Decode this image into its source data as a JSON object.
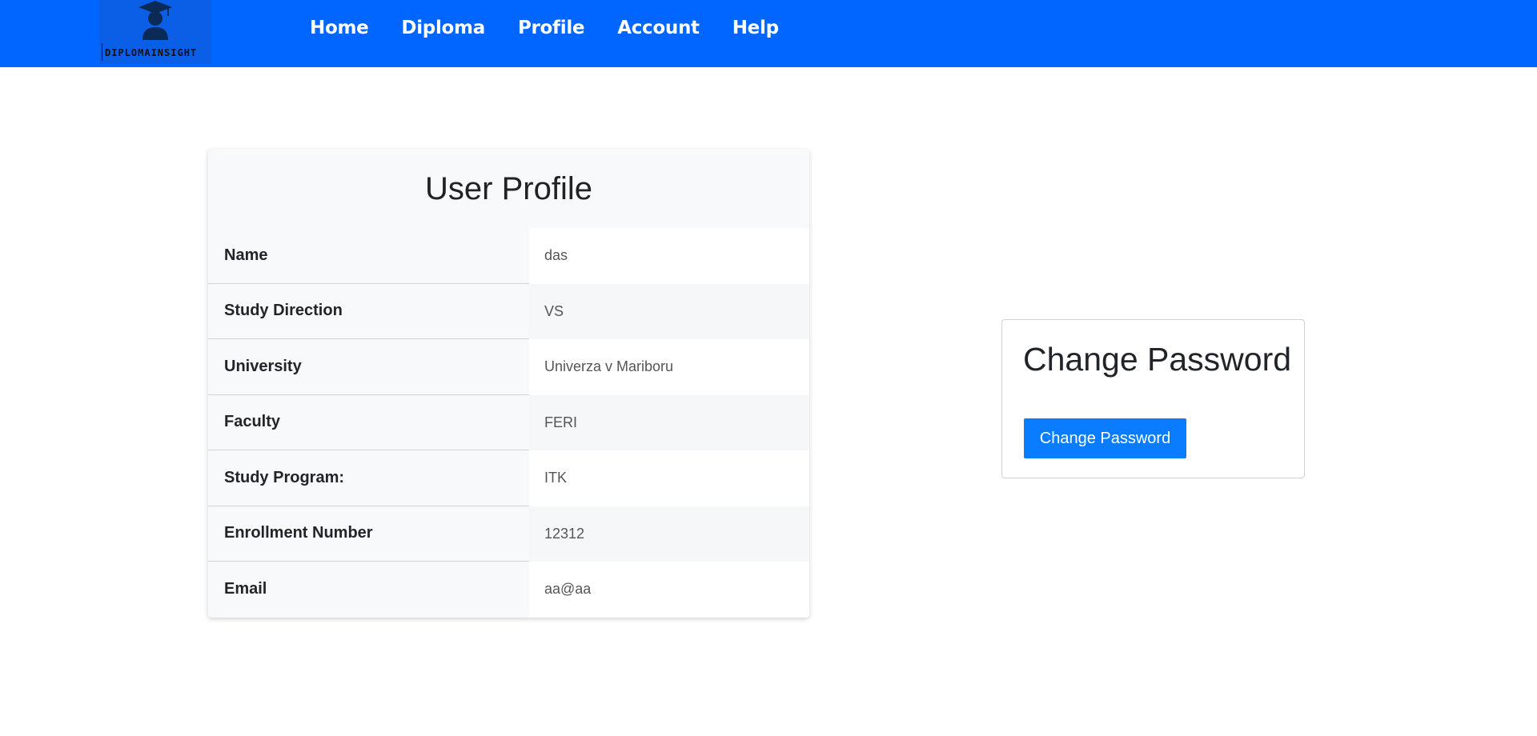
{
  "brand": {
    "name": "DIPLOMAINSIGHT",
    "logo_icon": "graduate-icon"
  },
  "nav": {
    "items": [
      {
        "label": "Home"
      },
      {
        "label": "Diploma"
      },
      {
        "label": "Profile"
      },
      {
        "label": "Account"
      },
      {
        "label": "Help"
      }
    ]
  },
  "profile": {
    "title": "User Profile",
    "rows": [
      {
        "label": "Name",
        "value": "das"
      },
      {
        "label": "Study Direction",
        "value": "VS"
      },
      {
        "label": "University",
        "value": "Univerza v Mariboru"
      },
      {
        "label": "Faculty",
        "value": "FERI"
      },
      {
        "label": "Study Program:",
        "value": "ITK"
      },
      {
        "label": "Enrollment Number",
        "value": "12312"
      },
      {
        "label": "Email",
        "value": "aa@aa"
      }
    ]
  },
  "password": {
    "title": "Change Password",
    "button_label": "Change Password"
  },
  "colors": {
    "navbar": "#0066ff",
    "button": "#0a7cff"
  }
}
